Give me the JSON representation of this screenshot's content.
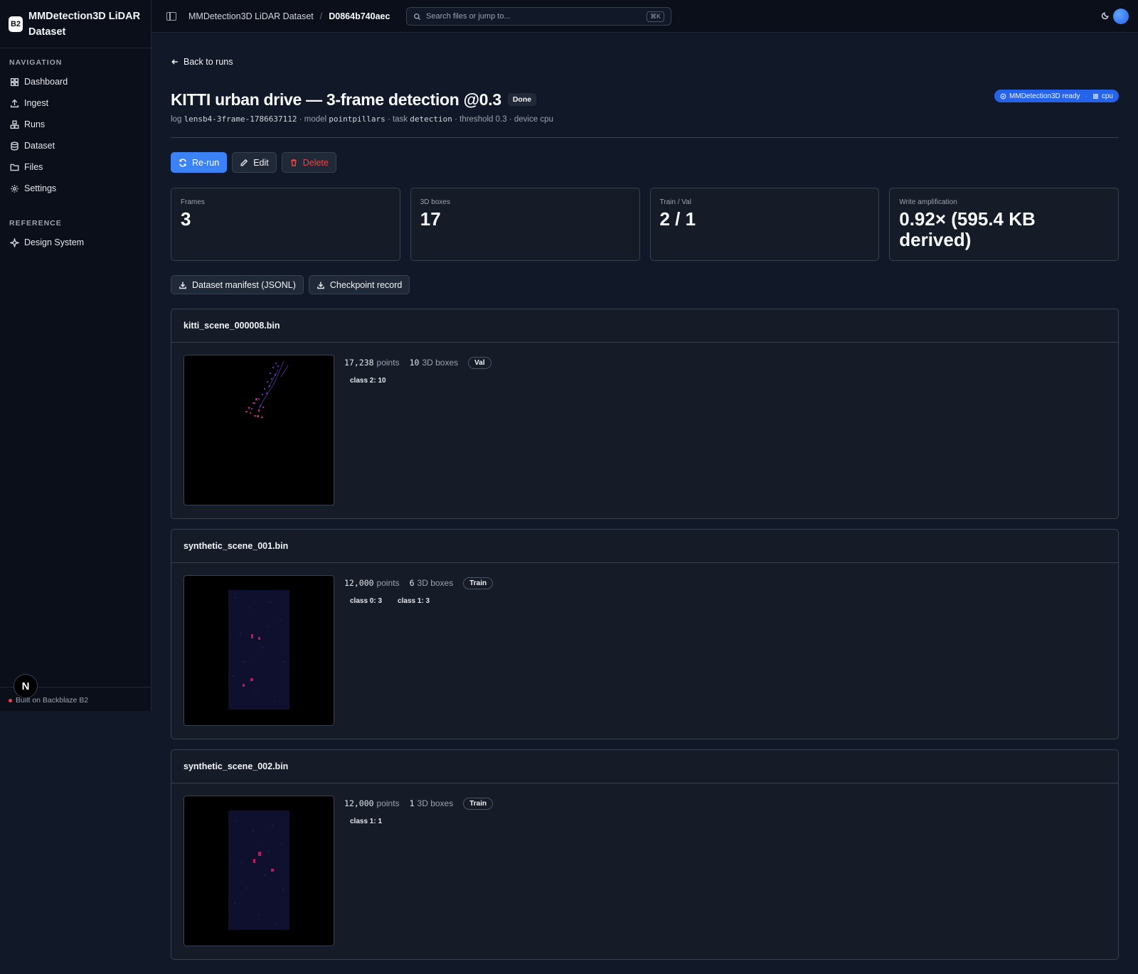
{
  "app": {
    "logo": "B2",
    "name": "MMDetection3D LiDAR Dataset"
  },
  "sidebar": {
    "nav_heading": "NAVIGATION",
    "nav_items": [
      {
        "label": "Dashboard",
        "icon": "grid-icon"
      },
      {
        "label": "Ingest",
        "icon": "upload-icon"
      },
      {
        "label": "Runs",
        "icon": "boxes-icon"
      },
      {
        "label": "Dataset",
        "icon": "database-icon"
      },
      {
        "label": "Files",
        "icon": "folder-icon"
      },
      {
        "label": "Settings",
        "icon": "gear-icon"
      }
    ],
    "ref_heading": "REFERENCE",
    "ref_items": [
      {
        "label": "Design System",
        "icon": "sparkle-icon"
      }
    ],
    "footer": "Built on Backblaze B2",
    "badge": "N"
  },
  "topbar": {
    "crumbs": [
      "MMDetection3D LiDAR Dataset",
      "D0864b740aec"
    ],
    "separator": "/",
    "search_placeholder": "Search files or jump to...",
    "search_shortcut": "⌘K"
  },
  "page": {
    "back_label": "Back to runs",
    "title": "KITTI urban drive — 3-frame detection @0.3",
    "status": "Done",
    "ready_label": "MMDetection3D ready",
    "device_label": "cpu",
    "meta": {
      "log_label": "log",
      "log_value": "lensb4-3frame-1786637112",
      "model_label": "model",
      "model_value": "pointpillars",
      "task_label": "task",
      "task_value": "detection",
      "threshold_label": "threshold",
      "threshold_value": "0.3",
      "device_label": "device",
      "device_value": "cpu"
    },
    "actions": {
      "rerun": "Re-run",
      "edit": "Edit",
      "delete": "Delete"
    },
    "stats": [
      {
        "label": "Frames",
        "value": "3"
      },
      {
        "label": "3D boxes",
        "value": "17"
      },
      {
        "label": "Train / Val",
        "value": "2 / 1"
      },
      {
        "label": "Write amplification",
        "value": "0.92× (595.4 KB derived)"
      }
    ],
    "downloads": {
      "manifest": "Dataset manifest (JSONL)",
      "checkpoint": "Checkpoint record"
    }
  },
  "scenes": [
    {
      "file": "kitti_scene_000008.bin",
      "points": "17,238",
      "points_label": "points",
      "boxes": "10",
      "boxes_label": "3D boxes",
      "split": "Val",
      "classes": [
        "class 2: 10"
      ]
    },
    {
      "file": "synthetic_scene_001.bin",
      "points": "12,000",
      "points_label": "points",
      "boxes": "6",
      "boxes_label": "3D boxes",
      "split": "Train",
      "classes": [
        "class 0: 3",
        "class 1: 3"
      ]
    },
    {
      "file": "synthetic_scene_002.bin",
      "points": "12,000",
      "points_label": "points",
      "boxes": "1",
      "boxes_label": "3D boxes",
      "split": "Train",
      "classes": [
        "class 1: 1"
      ]
    }
  ]
}
